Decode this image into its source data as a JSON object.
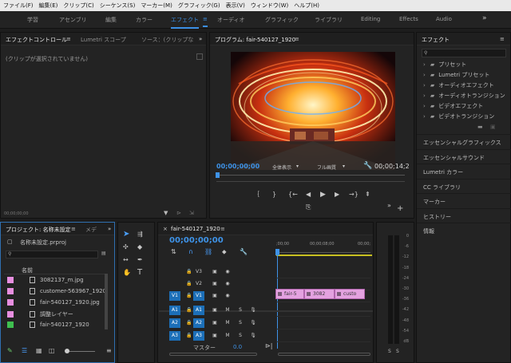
{
  "menu": [
    "ファイル(F)",
    "編集(E)",
    "クリップ(C)",
    "シーケンス(S)",
    "マーカー(M)",
    "グラフィック(G)",
    "表示(V)",
    "ウィンドウ(W)",
    "ヘルプ(H)"
  ],
  "workspaces": {
    "items": [
      "学習",
      "アセンブリ",
      "編集",
      "カラー",
      "エフェクト",
      "オーディオ",
      "グラフィック",
      "ライブラリ",
      "Editing",
      "Effects",
      "Audio"
    ],
    "active": "エフェクト",
    "more": "»"
  },
  "effect_controls": {
    "tabs": [
      "エフェクトコントロール",
      "Lumetri スコープ",
      "ソース：(クリップな"
    ],
    "empty_message": "(クリップが選択されていません)",
    "timecode": "00;00;00;00"
  },
  "program_monitor": {
    "title": "プログラム: fair-540127_1920",
    "current_time": "00;00;00;00",
    "zoom": "全体表示",
    "quality": "フル画質",
    "duration": "00;00;14;2"
  },
  "effects_panel": {
    "title": "エフェクト",
    "folders": [
      "プリセット",
      "Lumetri プリセット",
      "オーディオエフェクト",
      "オーディオトランジション",
      "ビデオエフェクト",
      "ビデオトランジション"
    ],
    "sections": [
      "エッセンシャルグラフィックス",
      "エッセンシャルサウンド",
      "Lumetri カラー",
      "CC ライブラリ",
      "マーカー",
      "ヒストリー",
      "情報"
    ]
  },
  "project": {
    "tabs": [
      "プロジェクト: 名称未設定",
      "メデ"
    ],
    "file": "名称未設定.prproj",
    "column_name": "名前",
    "items": [
      {
        "name": "3082137_m.jpg",
        "color": "#e88ee0"
      },
      {
        "name": "customer-563967_1920",
        "color": "#e88ee0"
      },
      {
        "name": "fair-540127_1920.jpg",
        "color": "#e88ee0"
      },
      {
        "name": "調整レイヤー",
        "color": "#e88ee0"
      },
      {
        "name": "fair-540127_1920",
        "color": "#3fbf4f"
      }
    ]
  },
  "timeline": {
    "title": "fair-540127_1920",
    "timecode": "00;00;00;00",
    "ruler": [
      ";00;00",
      "00;00;08;00",
      "00;00;"
    ],
    "video_tracks": [
      "V3",
      "V2",
      "V1"
    ],
    "audio_tracks": [
      "A1",
      "A2",
      "A3"
    ],
    "source_video": "V1",
    "source_audio": [
      "A1",
      "A2",
      "A3"
    ],
    "mute_label": "M",
    "solo_label": "S",
    "master_label": "マスター",
    "master_value": "0.0",
    "clips": [
      "fair-5",
      "3082",
      "custo"
    ]
  },
  "meter": {
    "ticks": [
      "0",
      "-6",
      "-12",
      "-18",
      "-24",
      "-30",
      "-36",
      "-42",
      "-48",
      "-54",
      "dB"
    ],
    "solo": [
      "S",
      "S"
    ]
  }
}
